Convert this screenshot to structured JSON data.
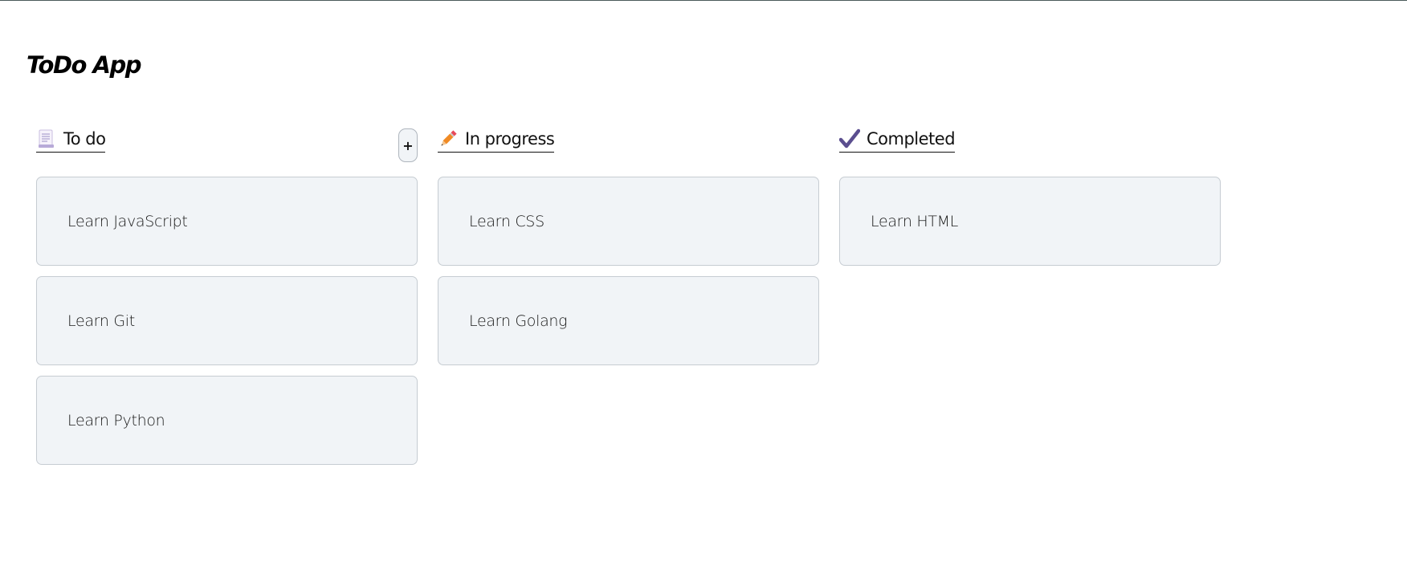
{
  "app": {
    "title": "ToDo App"
  },
  "columns": [
    {
      "icon": "memo-icon",
      "title": "To do",
      "has_add_button": true,
      "add_label": "+",
      "cards": [
        "Learn JavaScript",
        "Learn Git",
        "Learn Python"
      ]
    },
    {
      "icon": "pencil-icon",
      "title": "In progress",
      "has_add_button": false,
      "cards": [
        "Learn CSS",
        "Learn Golang"
      ]
    },
    {
      "icon": "check-mark-icon",
      "title": "Completed",
      "has_add_button": false,
      "cards": [
        "Learn HTML"
      ]
    }
  ],
  "colors": {
    "card_bg": "#f1f4f7",
    "card_border": "#c6ccd2",
    "check": "#5b4e8f",
    "pencil": "#f08a24",
    "pencil_tip": "#e8495a"
  }
}
